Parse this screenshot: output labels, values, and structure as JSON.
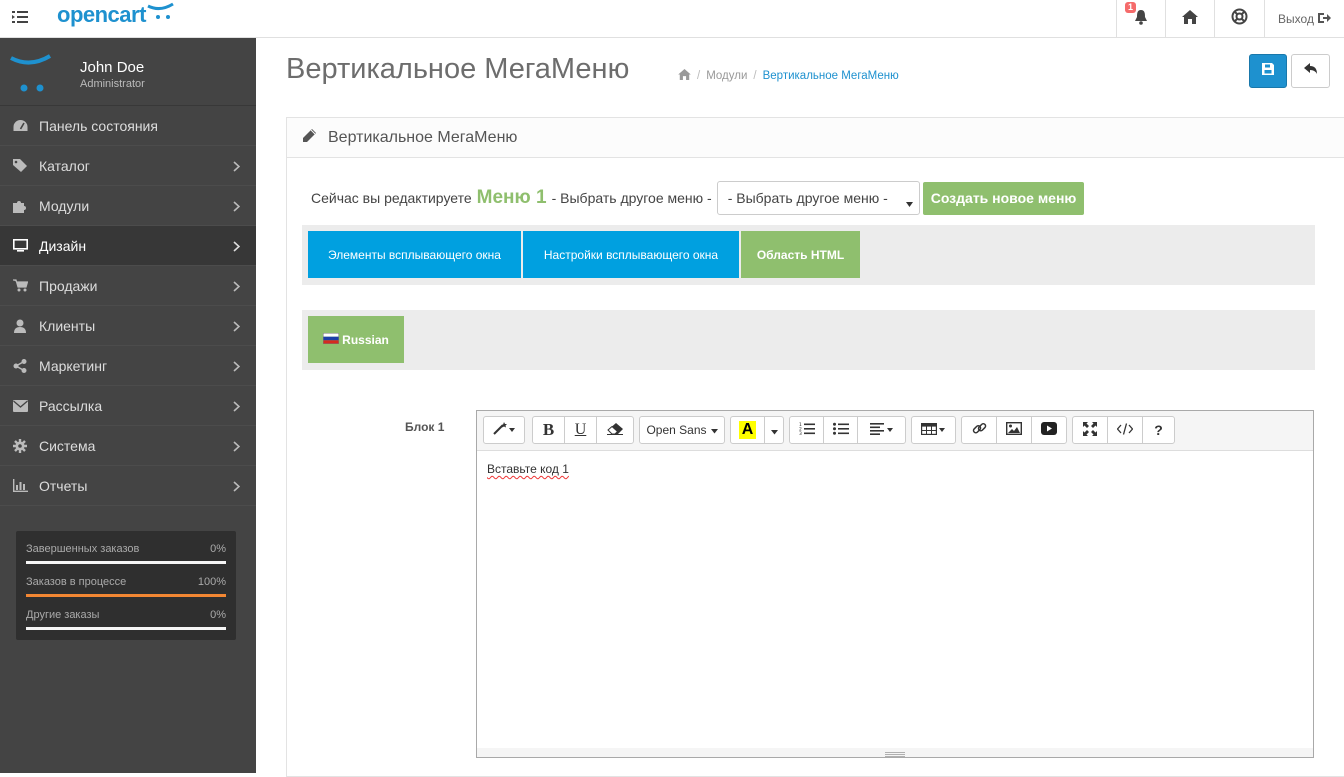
{
  "header": {
    "logo_text": "opencart",
    "notification_count": "1",
    "logout_label": "Выход"
  },
  "profile": {
    "name": "John Doe",
    "role": "Administrator"
  },
  "nav": {
    "items": [
      {
        "label": "Панель состояния",
        "icon": "dashboard-icon"
      },
      {
        "label": "Каталог",
        "icon": "tags-icon"
      },
      {
        "label": "Модули",
        "icon": "puzzle-icon"
      },
      {
        "label": "Дизайн",
        "icon": "monitor-icon",
        "active": true
      },
      {
        "label": "Продажи",
        "icon": "cart-icon"
      },
      {
        "label": "Клиенты",
        "icon": "user-icon"
      },
      {
        "label": "Маркетинг",
        "icon": "share-icon"
      },
      {
        "label": "Рассылка",
        "icon": "envelope-icon"
      },
      {
        "label": "Система",
        "icon": "cog-icon"
      },
      {
        "label": "Отчеты",
        "icon": "bar-chart-icon"
      }
    ]
  },
  "stats": {
    "items": [
      {
        "label": "Завершенных заказов",
        "value": "0%",
        "progress": 0,
        "color": "#f5f5f5"
      },
      {
        "label": "Заказов в процессе",
        "value": "100%",
        "progress": 1.0,
        "color": "#f38733"
      },
      {
        "label": "Другие заказы",
        "value": "0%",
        "progress": 0,
        "color": "#f5f5f5"
      }
    ]
  },
  "page": {
    "title": "Вертикальное МегаМеню",
    "breadcrumb": [
      "Модули",
      "Вертикальное МегаМеню"
    ]
  },
  "panel": {
    "heading": "Вертикальное МегаМеню",
    "editing_prefix": "Сейчас вы редактируете",
    "menu_name": "Меню 1",
    "select_prompt": "- Выбрать другое меню -",
    "select_value": "- Выбрать другое меню -",
    "create_button": "Создать новое меню",
    "tabs": [
      "Элементы всплывающего окна",
      "Настройки всплывающего окна",
      "Область HTML"
    ],
    "language": "Russian",
    "block_label": "Блок 1",
    "editor_font": "Open Sans",
    "editor_content": "Вставьте код 1"
  },
  "colors": {
    "accent_blue": "#1e91cf",
    "tab_blue": "#00a0e0",
    "green": "#8fbf6e",
    "sidebar": "#444444"
  }
}
